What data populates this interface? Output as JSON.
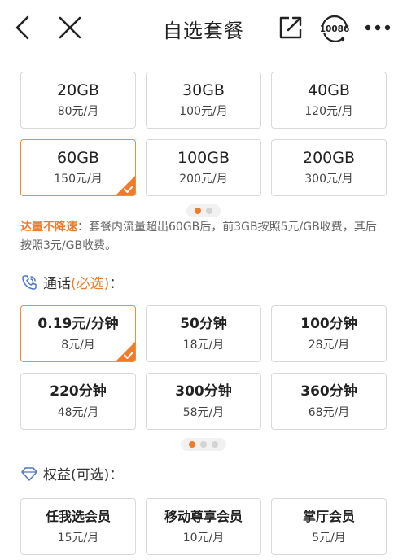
{
  "header": {
    "title": "自选套餐",
    "service_number": "10086"
  },
  "data_plans": [
    {
      "amount": "20GB",
      "price": "80元/月",
      "selected": false
    },
    {
      "amount": "30GB",
      "price": "100元/月",
      "selected": false
    },
    {
      "amount": "40GB",
      "price": "120元/月",
      "selected": false
    },
    {
      "amount": "60GB",
      "price": "150元/月",
      "selected": true
    },
    {
      "amount": "100GB",
      "price": "200元/月",
      "selected": false
    },
    {
      "amount": "200GB",
      "price": "300元/月",
      "selected": false
    }
  ],
  "data_pager": {
    "count": 2,
    "active": 0
  },
  "note": {
    "highlight": "达量不降速",
    "text": "：套餐内流量超出60GB后，前3GB按照5元/GB收费，其后按照3元/GB收费。"
  },
  "voice_section": {
    "label": "通话",
    "qualifier": "(必选)",
    "suffix": "："
  },
  "voice_plans": [
    {
      "amount": "0.19元/分钟",
      "price": "8元/月",
      "selected": true
    },
    {
      "amount": "50分钟",
      "price": "18元/月",
      "selected": false
    },
    {
      "amount": "100分钟",
      "price": "28元/月",
      "selected": false
    },
    {
      "amount": "220分钟",
      "price": "48元/月",
      "selected": false
    },
    {
      "amount": "300分钟",
      "price": "58元/月",
      "selected": false
    },
    {
      "amount": "360分钟",
      "price": "68元/月",
      "selected": false
    }
  ],
  "voice_pager": {
    "count": 3,
    "active": 0
  },
  "benefit_section": {
    "label": "权益(可选)",
    "suffix": "："
  },
  "benefit_plans": [
    {
      "amount": "任我选会员",
      "price": "15元/月",
      "selected": false
    },
    {
      "amount": "移动尊享会员",
      "price": "10元/月",
      "selected": false
    },
    {
      "amount": "掌厅会员",
      "price": "5元/月",
      "selected": false
    }
  ],
  "colors": {
    "accent": "#f07c2b",
    "selected_border": "#f08c3a",
    "card_border": "#d9d9d9"
  },
  "icons": {
    "back": "chevron-left-icon",
    "close": "close-icon",
    "share": "share-icon",
    "service": "customer-service-icon",
    "more": "more-icon",
    "phone": "phone-icon",
    "benefit": "diamond-icon",
    "check": "check-icon"
  }
}
